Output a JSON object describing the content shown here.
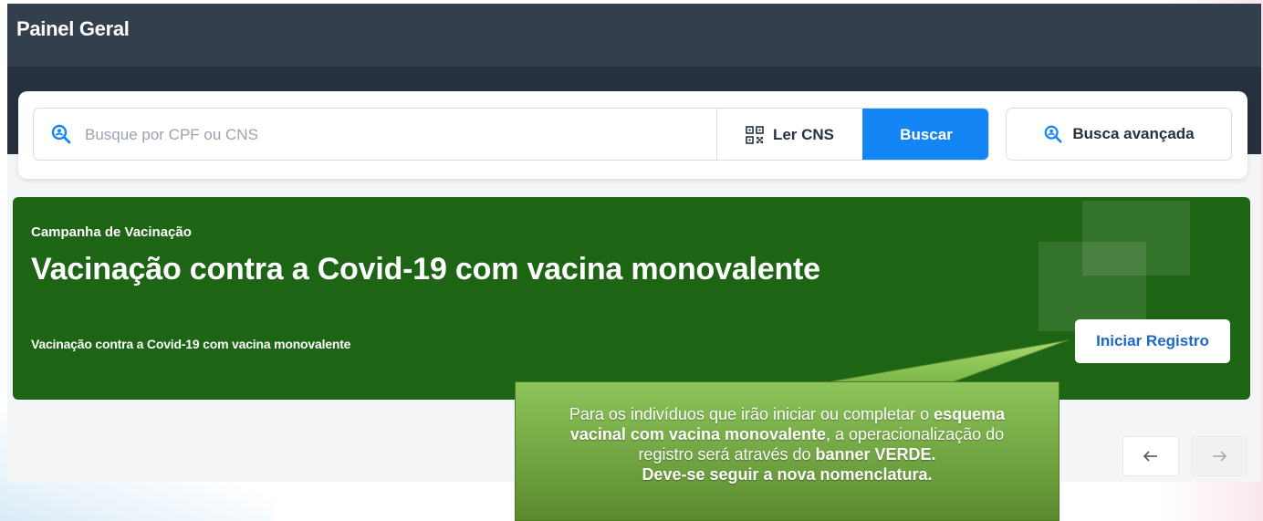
{
  "header": {
    "title": "Painel Geral"
  },
  "search": {
    "placeholder": "Busque por CPF ou CNS",
    "read_cns_label": "Ler CNS",
    "search_button_label": "Buscar",
    "advanced_search_label": "Busca avançada"
  },
  "banner": {
    "kicker": "Campanha de Vacinação",
    "title": "Vacinação contra a Covid-19 com vacina monovalente",
    "description": "Vacinação contra a Covid-19 com vacina monovalente",
    "cta_label": "Iniciar Registro",
    "background_color": "#1d6414"
  },
  "carousel": {
    "prev_icon": "arrow-left-icon",
    "next_icon": "arrow-right-icon"
  },
  "callout": {
    "line1_pre": "Para os indivíduos que irão iniciar ou completar o ",
    "line1_bold": "esquema",
    "line2_bold": "vacinal com vacina monovalente",
    "line2_post": ", a operacionalização do",
    "line3_pre": "registro será através do ",
    "line3_bold": "banner VERDE.",
    "line4_bold": "Deve-se seguir a nova nomenclatura.",
    "color": "#7ab648"
  },
  "colors": {
    "header": "#343f4e",
    "primary": "#1485f5",
    "link": "#1a68c9"
  }
}
